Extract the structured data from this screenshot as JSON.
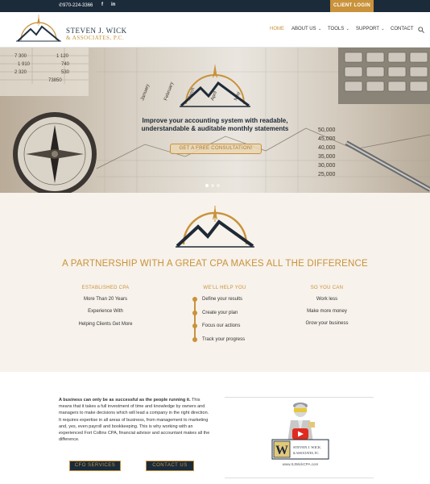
{
  "topbar": {
    "phone": "970-224-3366",
    "facebook": "f",
    "linkedin": "in",
    "client_login": "CLIENT LOGIN"
  },
  "logo": {
    "name": "STEVEN J. WICK",
    "sub": "& ASSOCIATES, P.C."
  },
  "nav": {
    "items": [
      {
        "label": "HOME",
        "active": true
      },
      {
        "label": "ABOUT US",
        "dropdown": true
      },
      {
        "label": "TOOLS",
        "dropdown": true
      },
      {
        "label": "SUPPORT",
        "dropdown": true
      },
      {
        "label": "CONTACT"
      }
    ],
    "search_icon": "search-icon"
  },
  "hero": {
    "heading": "Improve your accounting system with readable, understandable & auditable monthly statements",
    "button": "GET A FREE CONSULTATION!",
    "slides": 3,
    "active_slide": 1,
    "ledger_numbers": [
      "7 300",
      "1 120",
      "1 910",
      "740",
      "2 320",
      "530",
      "73850"
    ],
    "axis_numbers": [
      "50,000",
      "45,000",
      "40,000",
      "35,000",
      "30,000",
      "25,000"
    ],
    "months": [
      "January",
      "February",
      "March",
      "April",
      "May"
    ]
  },
  "partnership": {
    "title": "A PARTNERSHIP WITH A GREAT CPA MAKES ALL THE DIFFERENCE",
    "columns": [
      {
        "title": "ESTABLISHED CPA",
        "items": [
          "More Than 20 Years",
          "Experience With",
          "Helping Clients Get More"
        ]
      },
      {
        "title": "WE'LL HELP YOU",
        "items": [
          "Define your results",
          "Create your plan",
          "Focus our actions",
          "Track your progress"
        ]
      },
      {
        "title": "SO YOU CAN",
        "items": [
          "Work less",
          "Make more money",
          "Grow your business"
        ]
      }
    ]
  },
  "about": {
    "lead": "A business can only be as successful as the people running it.",
    "body": " This means that it takes a full investment of time and knowledge by owners and managers to make decisions which will lead a company in the right direction. It requires expertise in all areas of business, from management to marketing and, yes, even payroll and bookkeeping. This is why working with an experienced Fort Collins CPA, financial advisor and accountant makes all the difference.",
    "buttons": [
      "CFO SERVICES",
      "CONTACT US"
    ],
    "video": {
      "brand_line1": "STEVEN J. WICK",
      "brand_line2": "& ASSOCIATES, P.C.",
      "monogram": "W",
      "caption": "www.SJWickCPA.com"
    }
  },
  "colors": {
    "navy": "#1b2b3a",
    "gold": "#c9923b",
    "cream": "#f7f2eb"
  }
}
